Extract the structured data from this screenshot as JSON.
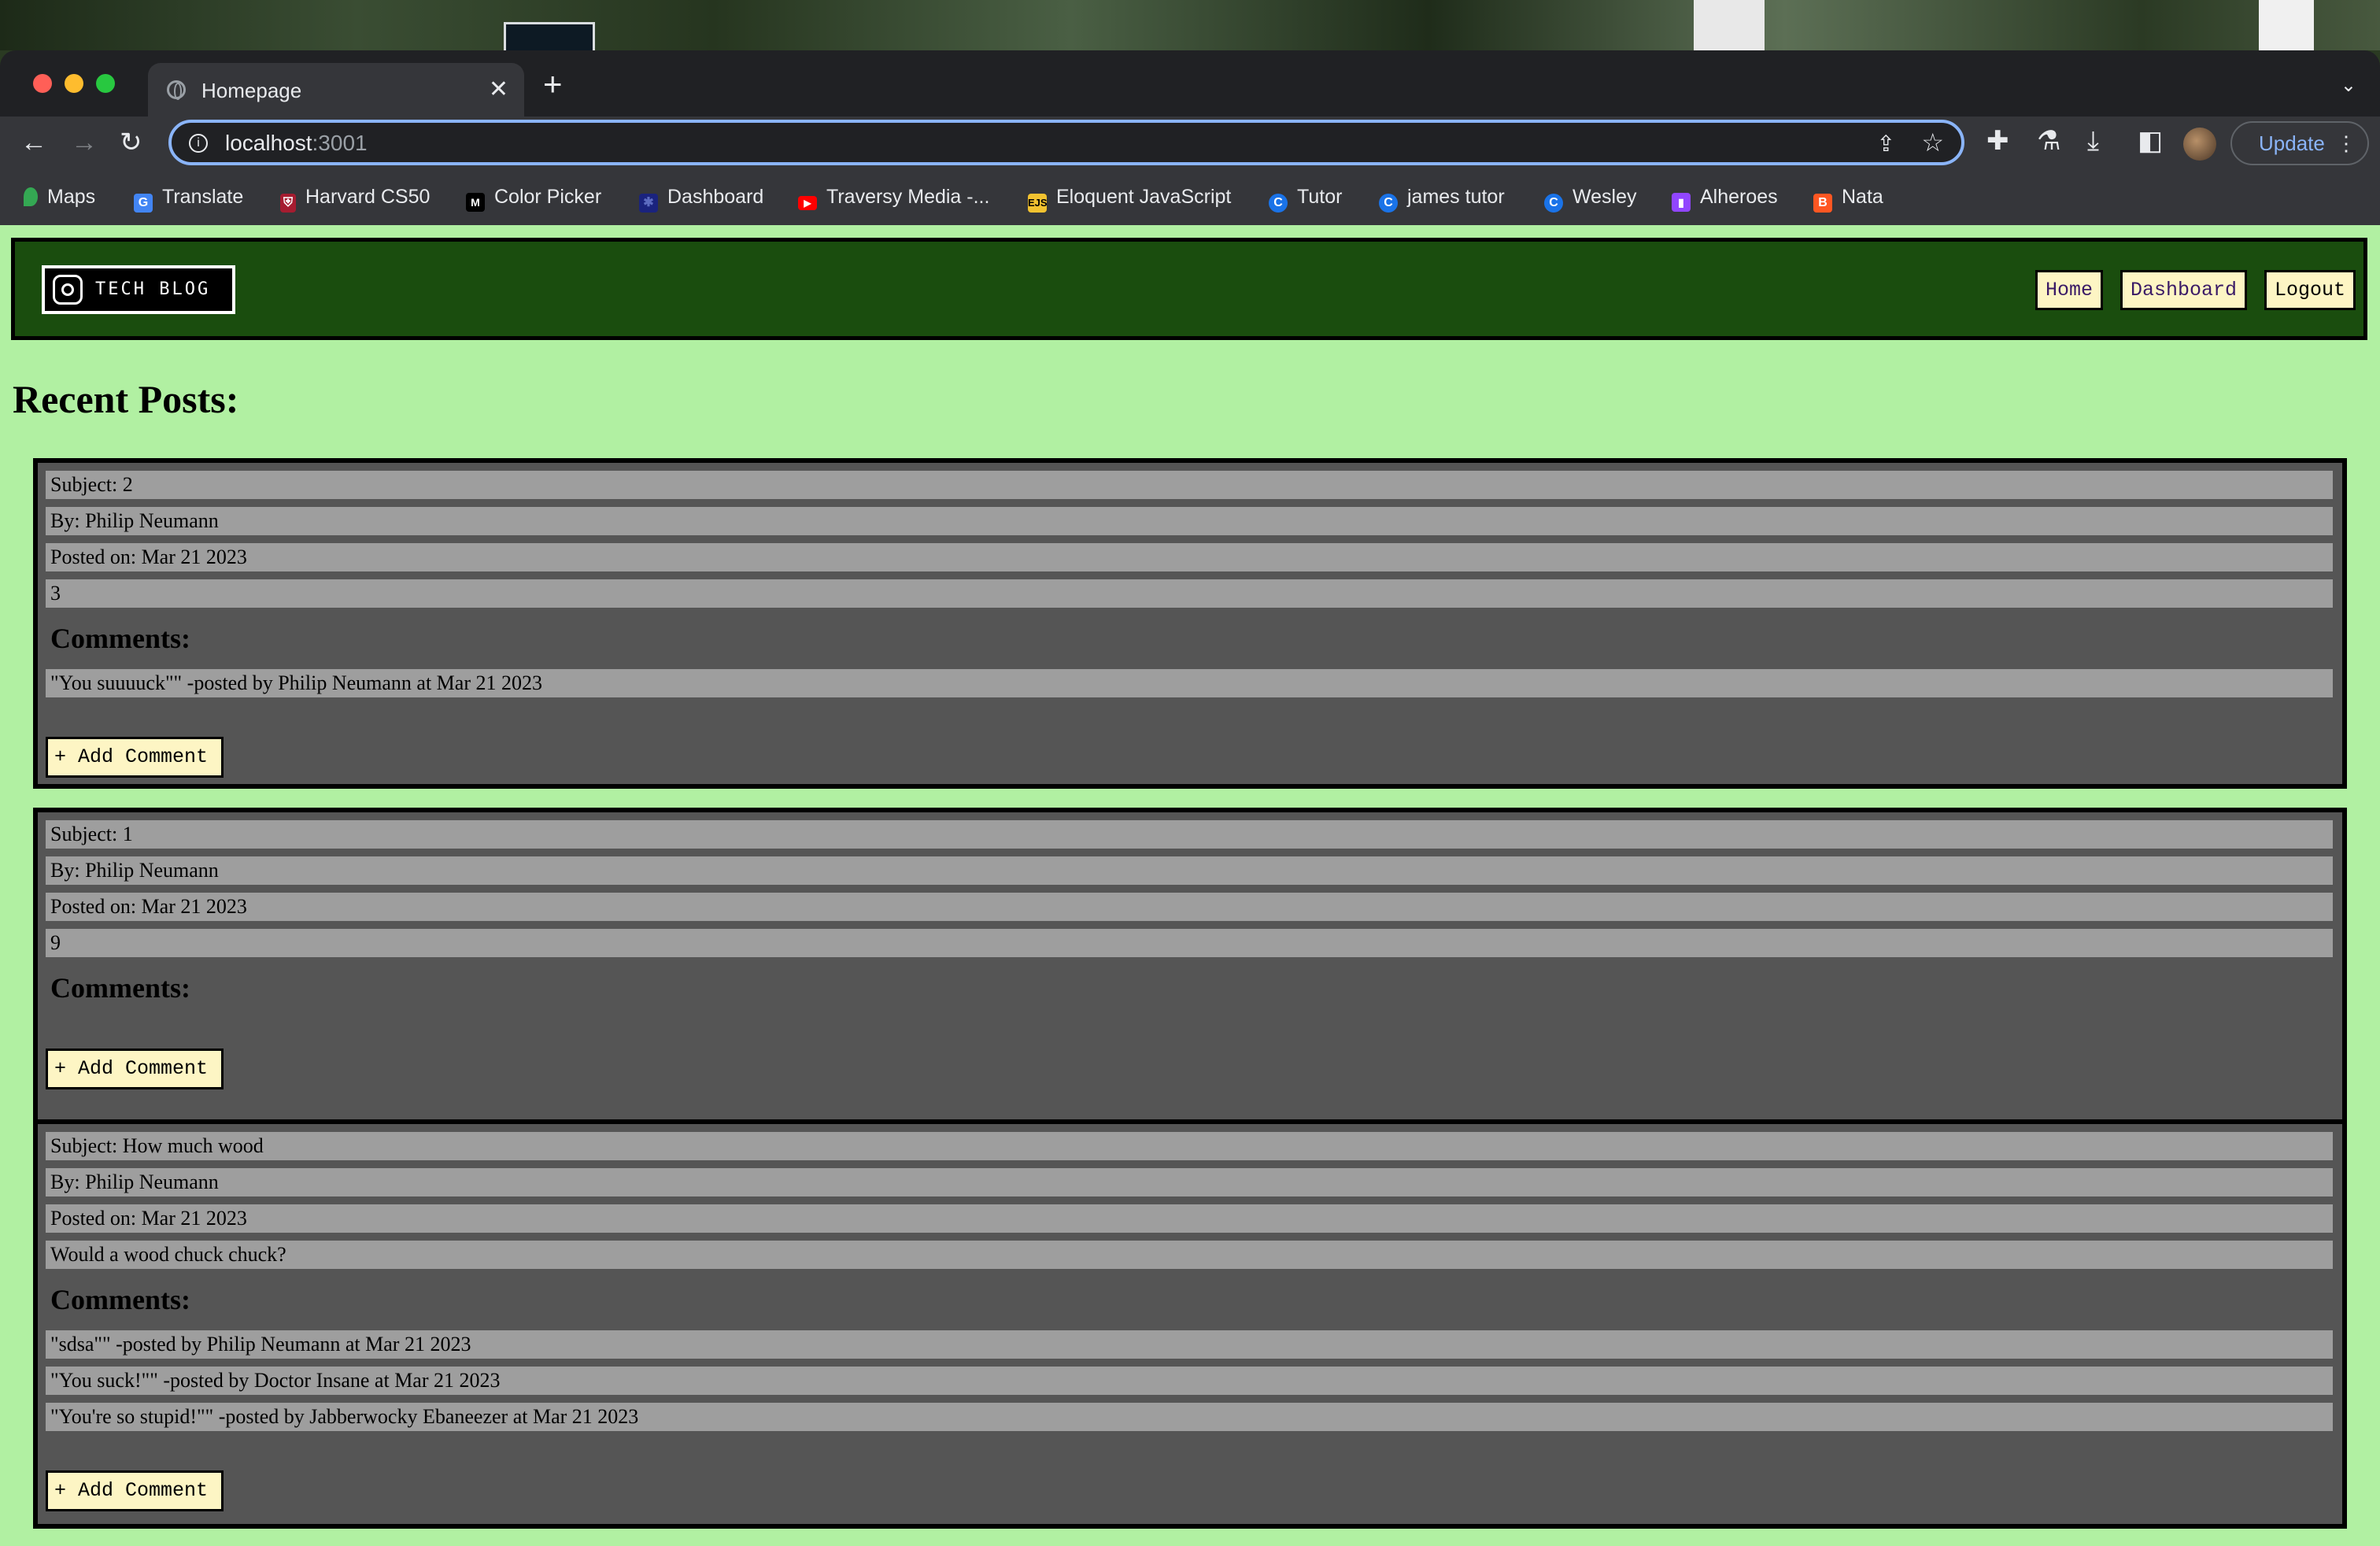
{
  "browser": {
    "tab_title": "Homepage",
    "url_host": "localhost",
    "url_port": ":3001",
    "update_label": "Update",
    "bookmarks": [
      {
        "label": "Maps",
        "icon": "maps-icon"
      },
      {
        "label": "Translate",
        "icon": "translate-icon"
      },
      {
        "label": "Harvard CS50",
        "icon": "harvard-icon"
      },
      {
        "label": "Color Picker",
        "icon": "color-picker-icon"
      },
      {
        "label": "Dashboard",
        "icon": "dashboard-icon"
      },
      {
        "label": "Traversy Media -...",
        "icon": "youtube-icon"
      },
      {
        "label": "Eloquent JavaScript",
        "icon": "ejs-icon"
      },
      {
        "label": "Tutor",
        "icon": "tutor-icon"
      },
      {
        "label": "james tutor",
        "icon": "tutor-icon"
      },
      {
        "label": "Wesley",
        "icon": "tutor-icon"
      },
      {
        "label": "Alheroes",
        "icon": "twitch-icon"
      },
      {
        "label": "Nata",
        "icon": "blogger-icon"
      }
    ]
  },
  "site": {
    "logo_text": "TECH BLOG",
    "nav": {
      "home": "Home",
      "dashboard": "Dashboard",
      "logout": "Logout"
    },
    "page_title": "Recent Posts:"
  },
  "posts": [
    {
      "subject": "Subject: 2",
      "author": "By: Philip Neumann",
      "date": "Posted on: Mar 21 2023",
      "body": "3",
      "comments_heading": "Comments:",
      "comments": [
        "\"You suuuuck\"\" -posted by Philip Neumann at Mar 21 2023"
      ],
      "add_label": "+ Add Comment"
    },
    {
      "subject": "Subject: 1",
      "author": "By: Philip Neumann",
      "date": "Posted on: Mar 21 2023",
      "body": "9",
      "comments_heading": "Comments:",
      "comments": [],
      "add_label": "+ Add Comment"
    },
    {
      "subject": "Subject: How much wood",
      "author": "By: Philip Neumann",
      "date": "Posted on: Mar 21 2023",
      "body": "Would a wood chuck chuck?",
      "comments_heading": "Comments:",
      "comments": [
        "\"sdsa\"\" -posted by Philip Neumann at Mar 21 2023",
        "\"You suck!\"\" -posted by Doctor Insane at Mar 21 2023",
        "\"You're so stupid!\"\" -posted by Jabberwocky Ebaneezer at Mar 21 2023"
      ],
      "add_label": "+ Add Comment"
    }
  ]
}
